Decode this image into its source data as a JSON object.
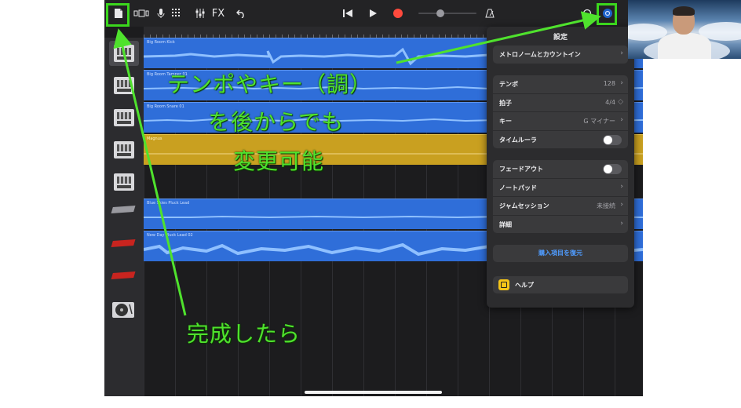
{
  "toolbar": {
    "icons": [
      "document-icon",
      "view-toggle-icon",
      "mic-icon",
      "grid-icon",
      "mixer-icon",
      "undo-icon",
      "rewind-icon",
      "play-icon",
      "record-icon",
      "metronome-icon",
      "loop-icon",
      "settings-icon"
    ],
    "fx_label": "FX"
  },
  "tracks": [
    {
      "label": "Big Room Kick",
      "color": "#2f6ed9"
    },
    {
      "label": "Big Room Tamper 01",
      "color": "#2f6ed9"
    },
    {
      "label": "Big Room Snare 01",
      "color": "#2f6ed9"
    },
    {
      "label": "Magnus",
      "color": "#c9a020"
    },
    {
      "label": "",
      "color": ""
    },
    {
      "label": "Blue Skies Pluck Lead",
      "color": "#2f6ed9"
    },
    {
      "label": "New Day Pluck Lead 02",
      "color": "#2f6ed9"
    }
  ],
  "add_track_label": "+",
  "settings": {
    "title": "設定",
    "metronome_label": "メトロノームとカウントイン",
    "tempo_label": "テンポ",
    "tempo_value": "128",
    "time_sig_label": "拍子",
    "time_sig_value": "4/4",
    "key_label": "キー",
    "key_value": "G マイナー",
    "time_ruler_label": "タイムルーラ",
    "fade_out_label": "フェードアウト",
    "note_pad_label": "ノートパッド",
    "jam_label": "ジャムセッション",
    "jam_value": "未接続",
    "details_label": "詳細",
    "restore_label": "購入項目を復元",
    "help_label": "ヘルプ"
  },
  "annotations": {
    "line1": "テンポやキー（調）",
    "line2": "を後からでも",
    "line3": "変更可能",
    "done": "完成したら",
    "highlight_color": "#3bd61d"
  }
}
